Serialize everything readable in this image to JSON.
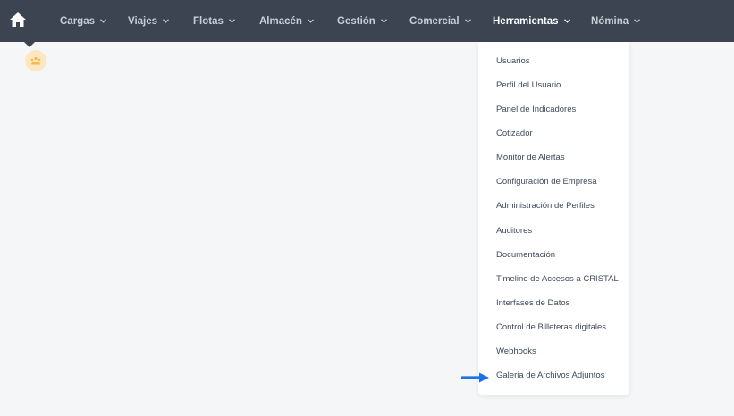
{
  "navbar": {
    "home_icon": "home-icon",
    "items": [
      {
        "label": "Cargas"
      },
      {
        "label": "Viajes"
      },
      {
        "label": "Flotas"
      },
      {
        "label": "Almacén"
      },
      {
        "label": "Gestión"
      },
      {
        "label": "Comercial"
      },
      {
        "label": "Herramientas",
        "active": true
      },
      {
        "label": "Nómina"
      }
    ],
    "bg_color": "#3b4450"
  },
  "avatar": {
    "icon": "user-avatar-icon",
    "color": "#fde7c3"
  },
  "dropdown": {
    "items": [
      "Usuarios",
      "Perfil del Usuario",
      "Panel de Indicadores",
      "Cotizador",
      "Monitor de Alertas",
      "Configuración de Empresa",
      "Administración de Perfiles",
      "Auditores",
      "Documentación",
      "Timeline de Accesos a CRISTAL",
      "Interfases de Datos",
      "Control de Billeteras digitales",
      "Webhooks",
      "Galeria de Archivos Adjuntos"
    ]
  },
  "annotation": {
    "icon": "arrow-right-icon",
    "color": "#1a73e8"
  }
}
